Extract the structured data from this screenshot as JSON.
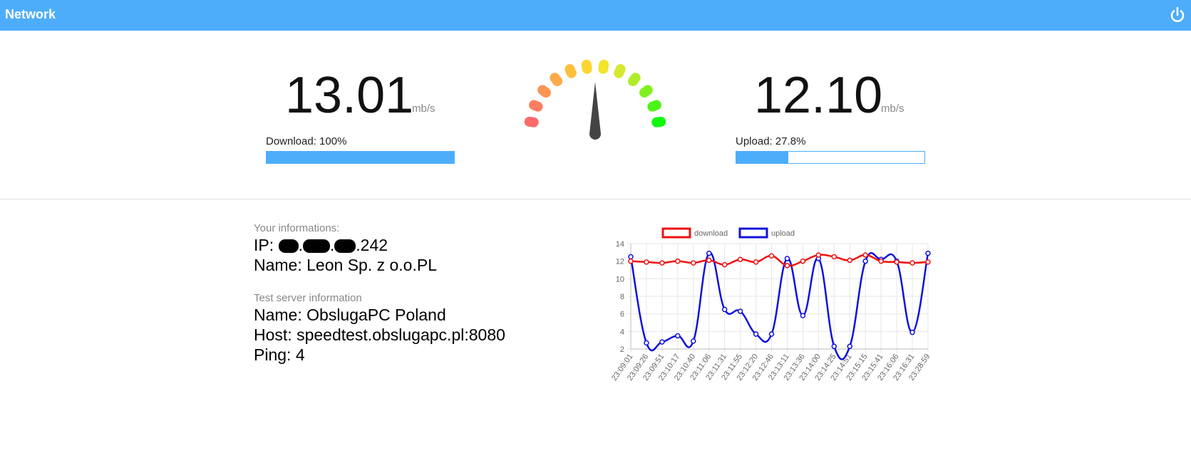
{
  "app": {
    "title": "Network",
    "power_icon": "power-icon"
  },
  "download": {
    "value": "13.01",
    "unit": "mb/s",
    "label": "Download: 100%",
    "progress": 1.0
  },
  "upload": {
    "value": "12.10",
    "unit": "mb/s",
    "label": "Upload: 27.8%",
    "progress": 0.278
  },
  "gauge": {
    "segment_colors": [
      "#fb6a6b",
      "#fb7f60",
      "#fc9454",
      "#fcaa48",
      "#fdbf3c",
      "#fdd530",
      "#f3e42c",
      "#d6e830",
      "#b0ec28",
      "#82f01f",
      "#4ef416",
      "#10f80e"
    ],
    "needle_color": "#444444"
  },
  "user_info": {
    "heading": "Your informations:",
    "ip_label": "IP:",
    "ip_suffix": ".242",
    "name_line": "Name: Leon Sp. z o.o.PL"
  },
  "server_info": {
    "heading": "Test server information",
    "name_line": "Name: ObslugaPC Poland",
    "host_line": "Host: speedtest.obslugapc.pl:8080",
    "ping_line": "Ping: 4"
  },
  "chart_data": {
    "type": "line",
    "categories": [
      "23:09:01",
      "23:09:26",
      "23:09:51",
      "23:10:17",
      "23:10:40",
      "23:11:06",
      "23:11:31",
      "23:11:55",
      "23:12:20",
      "23:12:46",
      "23:13:11",
      "23:13:36",
      "23:14:00",
      "23:14:25",
      "23:14:51",
      "23:15:15",
      "23:15:41",
      "23:16:06",
      "23:16:31",
      "23:28:59"
    ],
    "series": [
      {
        "name": "download",
        "color": "#ee1111",
        "values": [
          12.0,
          11.9,
          11.8,
          12.0,
          11.8,
          12.1,
          11.6,
          12.2,
          11.9,
          12.6,
          11.5,
          12.0,
          12.7,
          12.5,
          12.1,
          12.7,
          12.0,
          11.9,
          11.8,
          11.9
        ]
      },
      {
        "name": "upload",
        "color": "#1111dd",
        "values": [
          12.5,
          2.7,
          2.8,
          3.5,
          2.9,
          12.9,
          6.5,
          6.3,
          3.7,
          3.7,
          12.3,
          5.8,
          12.3,
          2.3,
          2.3,
          12.0,
          12.2,
          12.0,
          3.9,
          12.9
        ]
      }
    ],
    "ylim": [
      2,
      14
    ],
    "yticks": [
      2,
      4,
      6,
      8,
      10,
      12,
      14
    ],
    "grid": true,
    "legend": "top"
  }
}
